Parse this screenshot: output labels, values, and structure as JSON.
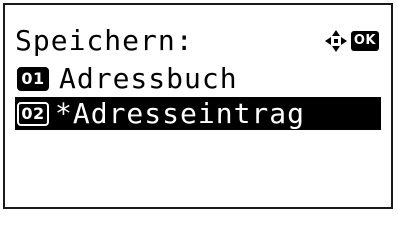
{
  "screen": {
    "title": "Speichern:",
    "nav_icons": [
      "dpad-arrows-icon",
      "ok-key-icon"
    ],
    "ok_label": "OK"
  },
  "menu": {
    "items": [
      {
        "number": "01",
        "label": "Adressbuch",
        "selected": false
      },
      {
        "number": "02",
        "label": "*Adresseintrag",
        "selected": true
      }
    ]
  }
}
